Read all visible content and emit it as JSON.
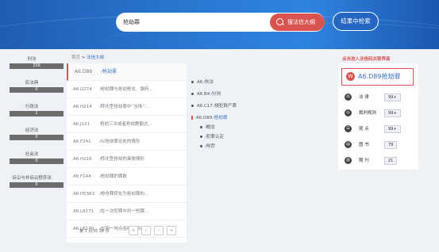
{
  "search": {
    "query": "抢劫罪",
    "button_label": "搜法信大纲",
    "result_button_label": "结果中检索"
  },
  "categories": [
    {
      "label": "刑法",
      "count": "336"
    },
    {
      "label": "民法典",
      "count": "0"
    },
    {
      "label": "行政法",
      "count": "1"
    },
    {
      "label": "经济法",
      "count": "0"
    },
    {
      "label": "社会法",
      "count": "0"
    },
    {
      "label": "诉讼与非诉讼程序法",
      "count": "0"
    }
  ],
  "breadcrumb": {
    "home": "首页",
    "separator": ">",
    "current": "法信大纲"
  },
  "list": {
    "items": [
      {
        "code": "A6.D89",
        "text": "抢劫罪"
      },
      {
        "code": "A6.G274",
        "text": "抢劫罪与抢劫枪支、弹药..."
      },
      {
        "code": "A6.H214",
        "text": "转化型抢劫罪中“当场”..."
      },
      {
        "code": "A6.J121",
        "text": "抢劫三次或者抢劫数额达..."
      },
      {
        "code": "A6.F241",
        "text": "以抢劫罪论处的情形"
      },
      {
        "code": "A6.H216",
        "text": "转化型抢劫的具体情形"
      },
      {
        "code": "A6.F244",
        "text": "抢劫罪的罪数"
      },
      {
        "code": "A6.H5363",
        "text": "抢夺罪转化为抢劫罪的..."
      },
      {
        "code": "A6.L6171",
        "text": "在一次犯罪中对一些跟..."
      },
      {
        "code": "A6.L6170",
        "text": "在同一地点连续地对途..."
      }
    ],
    "pager": {
      "info": "第 1 页/共 36 页",
      "first": "«",
      "prev": "‹",
      "next": "›",
      "last": "»"
    }
  },
  "tree": {
    "nodes": [
      {
        "code": "A6",
        "label": "刑法"
      },
      {
        "code": "A6.B4",
        "label": "分则"
      },
      {
        "code": "A6.C17",
        "label": "侵犯财产罪"
      },
      {
        "code": "A6.D89",
        "label": "抢劫罪"
      }
    ],
    "children": [
      {
        "label": "概念"
      },
      {
        "label": "犯罪认定"
      },
      {
        "label": "刑罚"
      }
    ]
  },
  "annotation": "点击进入法信码关联界面",
  "panel": {
    "title_icon": "W",
    "title": "A6.D89抢劫罪",
    "stats": [
      {
        "icon": "law-icon",
        "glyph": "⚖",
        "label": "法    律",
        "value": "99+"
      },
      {
        "icon": "judgment-icon",
        "glyph": "◎",
        "label": "裁判规则",
        "value": "99+"
      },
      {
        "icon": "opinion-icon",
        "glyph": "☰",
        "label": "观    点",
        "value": "99+"
      },
      {
        "icon": "book-icon",
        "glyph": "▤",
        "label": "图    书",
        "value": "79"
      },
      {
        "icon": "journal-icon",
        "glyph": "▥",
        "label": "期    刊",
        "value": "21"
      }
    ]
  }
}
